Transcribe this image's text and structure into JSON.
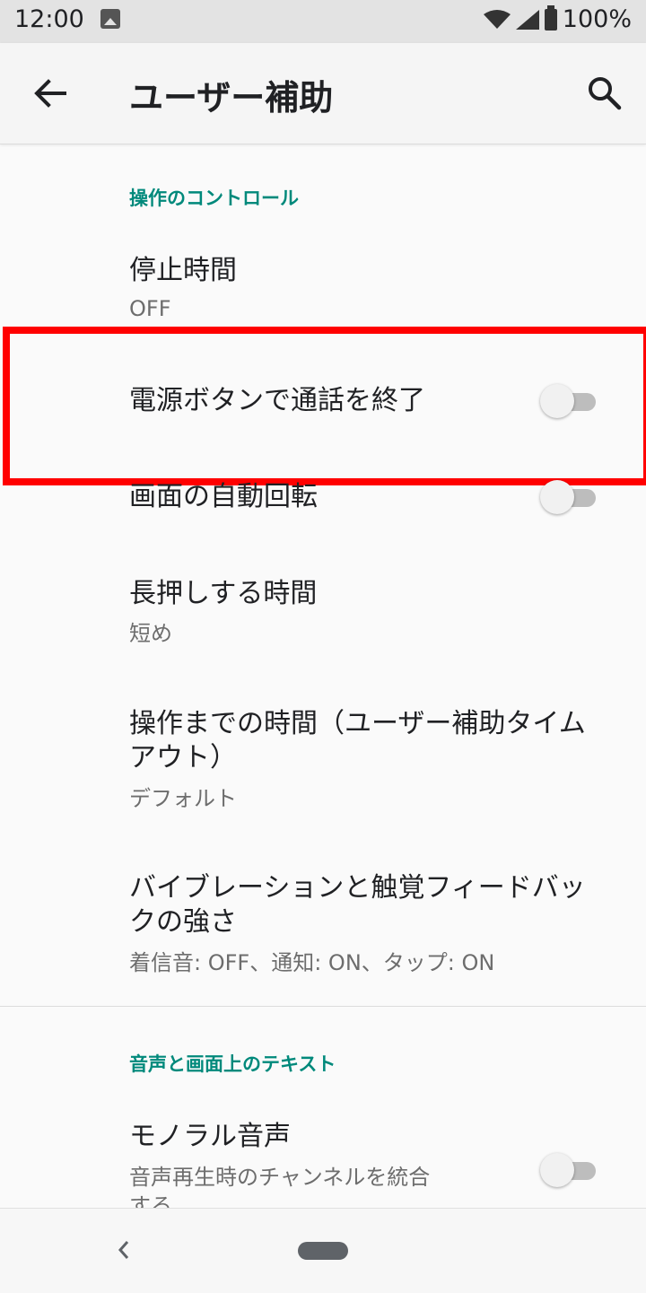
{
  "status_bar": {
    "time": "12:00",
    "battery": "100%",
    "icons": [
      "image-icon",
      "wifi-icon",
      "signal-icon",
      "battery-icon"
    ]
  },
  "app_bar": {
    "title": "ユーザー補助",
    "back_icon": "back-arrow-icon",
    "search_icon": "search-icon"
  },
  "sections": {
    "interaction": {
      "header": "操作のコントロール",
      "items": {
        "stop_time": {
          "title": "停止時間",
          "summary": "OFF"
        },
        "power_end_call": {
          "title": "電源ボタンで通話を終了",
          "toggle_on": false
        },
        "auto_rotate": {
          "title": "画面の自動回転",
          "toggle_on": false
        },
        "touch_hold": {
          "title": "長押しする時間",
          "summary": "短め"
        },
        "timeout": {
          "title_line1": "操作までの時間（ユーザー補助タイム",
          "title_line2": "アウト）",
          "summary": "デフォルト"
        },
        "vibration": {
          "title_line1": "バイブレーションと触覚フィードバッ",
          "title_line2": "クの強さ",
          "summary": "着信音: OFF、通知: ON、タップ: ON"
        }
      }
    },
    "audio_text": {
      "header": "音声と画面上のテキスト",
      "items": {
        "mono_audio": {
          "title": "モノラル音声",
          "summary_line1": "音声再生時のチャンネルを統合",
          "summary_line2": "する",
          "toggle_on": false
        }
      }
    }
  },
  "highlight_color": "#ff0000",
  "accent_color": "#00897b",
  "nav_bar": {
    "icons": [
      "nav-back-icon",
      "home-pill-icon"
    ]
  }
}
